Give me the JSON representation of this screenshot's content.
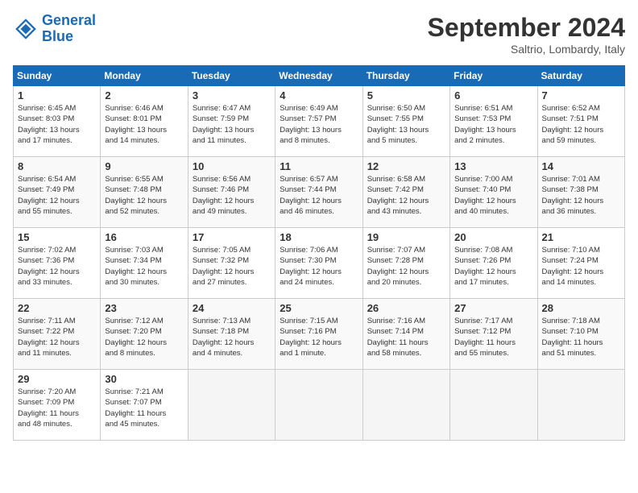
{
  "header": {
    "logo_line1": "General",
    "logo_line2": "Blue",
    "month": "September 2024",
    "location": "Saltrio, Lombardy, Italy"
  },
  "days_of_week": [
    "Sunday",
    "Monday",
    "Tuesday",
    "Wednesday",
    "Thursday",
    "Friday",
    "Saturday"
  ],
  "weeks": [
    [
      {
        "day": "1",
        "lines": [
          "Sunrise: 6:45 AM",
          "Sunset: 8:03 PM",
          "Daylight: 13 hours",
          "and 17 minutes."
        ]
      },
      {
        "day": "2",
        "lines": [
          "Sunrise: 6:46 AM",
          "Sunset: 8:01 PM",
          "Daylight: 13 hours",
          "and 14 minutes."
        ]
      },
      {
        "day": "3",
        "lines": [
          "Sunrise: 6:47 AM",
          "Sunset: 7:59 PM",
          "Daylight: 13 hours",
          "and 11 minutes."
        ]
      },
      {
        "day": "4",
        "lines": [
          "Sunrise: 6:49 AM",
          "Sunset: 7:57 PM",
          "Daylight: 13 hours",
          "and 8 minutes."
        ]
      },
      {
        "day": "5",
        "lines": [
          "Sunrise: 6:50 AM",
          "Sunset: 7:55 PM",
          "Daylight: 13 hours",
          "and 5 minutes."
        ]
      },
      {
        "day": "6",
        "lines": [
          "Sunrise: 6:51 AM",
          "Sunset: 7:53 PM",
          "Daylight: 13 hours",
          "and 2 minutes."
        ]
      },
      {
        "day": "7",
        "lines": [
          "Sunrise: 6:52 AM",
          "Sunset: 7:51 PM",
          "Daylight: 12 hours",
          "and 59 minutes."
        ]
      }
    ],
    [
      {
        "day": "8",
        "lines": [
          "Sunrise: 6:54 AM",
          "Sunset: 7:49 PM",
          "Daylight: 12 hours",
          "and 55 minutes."
        ]
      },
      {
        "day": "9",
        "lines": [
          "Sunrise: 6:55 AM",
          "Sunset: 7:48 PM",
          "Daylight: 12 hours",
          "and 52 minutes."
        ]
      },
      {
        "day": "10",
        "lines": [
          "Sunrise: 6:56 AM",
          "Sunset: 7:46 PM",
          "Daylight: 12 hours",
          "and 49 minutes."
        ]
      },
      {
        "day": "11",
        "lines": [
          "Sunrise: 6:57 AM",
          "Sunset: 7:44 PM",
          "Daylight: 12 hours",
          "and 46 minutes."
        ]
      },
      {
        "day": "12",
        "lines": [
          "Sunrise: 6:58 AM",
          "Sunset: 7:42 PM",
          "Daylight: 12 hours",
          "and 43 minutes."
        ]
      },
      {
        "day": "13",
        "lines": [
          "Sunrise: 7:00 AM",
          "Sunset: 7:40 PM",
          "Daylight: 12 hours",
          "and 40 minutes."
        ]
      },
      {
        "day": "14",
        "lines": [
          "Sunrise: 7:01 AM",
          "Sunset: 7:38 PM",
          "Daylight: 12 hours",
          "and 36 minutes."
        ]
      }
    ],
    [
      {
        "day": "15",
        "lines": [
          "Sunrise: 7:02 AM",
          "Sunset: 7:36 PM",
          "Daylight: 12 hours",
          "and 33 minutes."
        ]
      },
      {
        "day": "16",
        "lines": [
          "Sunrise: 7:03 AM",
          "Sunset: 7:34 PM",
          "Daylight: 12 hours",
          "and 30 minutes."
        ]
      },
      {
        "day": "17",
        "lines": [
          "Sunrise: 7:05 AM",
          "Sunset: 7:32 PM",
          "Daylight: 12 hours",
          "and 27 minutes."
        ]
      },
      {
        "day": "18",
        "lines": [
          "Sunrise: 7:06 AM",
          "Sunset: 7:30 PM",
          "Daylight: 12 hours",
          "and 24 minutes."
        ]
      },
      {
        "day": "19",
        "lines": [
          "Sunrise: 7:07 AM",
          "Sunset: 7:28 PM",
          "Daylight: 12 hours",
          "and 20 minutes."
        ]
      },
      {
        "day": "20",
        "lines": [
          "Sunrise: 7:08 AM",
          "Sunset: 7:26 PM",
          "Daylight: 12 hours",
          "and 17 minutes."
        ]
      },
      {
        "day": "21",
        "lines": [
          "Sunrise: 7:10 AM",
          "Sunset: 7:24 PM",
          "Daylight: 12 hours",
          "and 14 minutes."
        ]
      }
    ],
    [
      {
        "day": "22",
        "lines": [
          "Sunrise: 7:11 AM",
          "Sunset: 7:22 PM",
          "Daylight: 12 hours",
          "and 11 minutes."
        ]
      },
      {
        "day": "23",
        "lines": [
          "Sunrise: 7:12 AM",
          "Sunset: 7:20 PM",
          "Daylight: 12 hours",
          "and 8 minutes."
        ]
      },
      {
        "day": "24",
        "lines": [
          "Sunrise: 7:13 AM",
          "Sunset: 7:18 PM",
          "Daylight: 12 hours",
          "and 4 minutes."
        ]
      },
      {
        "day": "25",
        "lines": [
          "Sunrise: 7:15 AM",
          "Sunset: 7:16 PM",
          "Daylight: 12 hours",
          "and 1 minute."
        ]
      },
      {
        "day": "26",
        "lines": [
          "Sunrise: 7:16 AM",
          "Sunset: 7:14 PM",
          "Daylight: 11 hours",
          "and 58 minutes."
        ]
      },
      {
        "day": "27",
        "lines": [
          "Sunrise: 7:17 AM",
          "Sunset: 7:12 PM",
          "Daylight: 11 hours",
          "and 55 minutes."
        ]
      },
      {
        "day": "28",
        "lines": [
          "Sunrise: 7:18 AM",
          "Sunset: 7:10 PM",
          "Daylight: 11 hours",
          "and 51 minutes."
        ]
      }
    ],
    [
      {
        "day": "29",
        "lines": [
          "Sunrise: 7:20 AM",
          "Sunset: 7:09 PM",
          "Daylight: 11 hours",
          "and 48 minutes."
        ]
      },
      {
        "day": "30",
        "lines": [
          "Sunrise: 7:21 AM",
          "Sunset: 7:07 PM",
          "Daylight: 11 hours",
          "and 45 minutes."
        ]
      },
      {
        "day": "",
        "lines": []
      },
      {
        "day": "",
        "lines": []
      },
      {
        "day": "",
        "lines": []
      },
      {
        "day": "",
        "lines": []
      },
      {
        "day": "",
        "lines": []
      }
    ]
  ]
}
